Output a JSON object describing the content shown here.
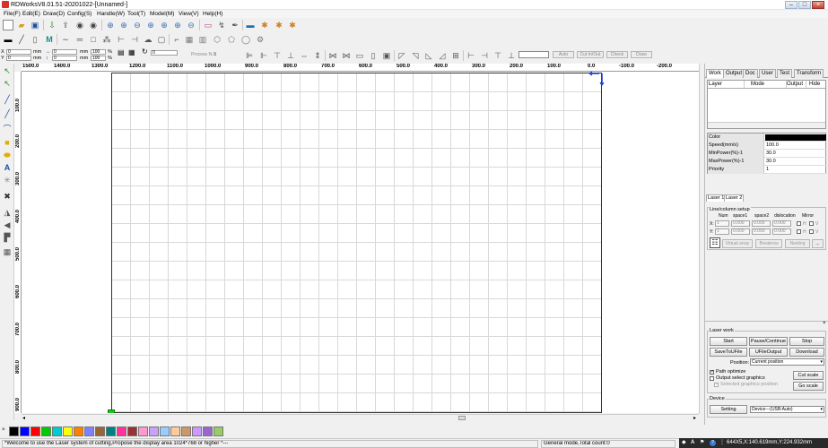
{
  "window": {
    "title": "RDWorksV8.01.51-20201022-[Unnamed-]"
  },
  "menu": [
    "File(F)",
    "Edit(E)",
    "Draw(D)",
    "Config(S)",
    "Handle(W)",
    "Tool(T)",
    "Model(M)",
    "View(V)",
    "Help(H)"
  ],
  "toolbar3": {
    "auto": "Auto",
    "cut_in_out": "Cut In/Out",
    "check": "Check",
    "draw": "Draw",
    "process_label": "Process N.0",
    "rotate_value": "0"
  },
  "coords": {
    "x_label": "X",
    "y_label": "Y",
    "x_value": "0",
    "y_value": "0",
    "unit": "mm",
    "w_value": "0",
    "h_value": "0",
    "pct_x": "100",
    "pct_y": "100",
    "pct": "%"
  },
  "ruler_top": [
    "1500.0",
    "1400.0",
    "1300.0",
    "1200.0",
    "1100.0",
    "1000.0",
    "900.0",
    "800.0",
    "700.0",
    "600.0",
    "500.0",
    "400.0",
    "300.0",
    "200.0",
    "100.0",
    "0.0",
    "-100.0",
    "-200.0"
  ],
  "ruler_left": [
    "100.0",
    "200.0",
    "300.0",
    "400.0",
    "500.0",
    "600.0",
    "700.0",
    "800.0",
    "900.0"
  ],
  "right_panel": {
    "tabs": [
      "Work",
      "Output",
      "Doc",
      "User",
      "Test",
      "Transform"
    ],
    "layer_headers": [
      "Layer",
      "Mode",
      "Output",
      "Hide"
    ],
    "props": [
      {
        "label": "Color",
        "value": ""
      },
      {
        "label": "Speed(mm/s)",
        "value": "100.0"
      },
      {
        "label": "MinPower(%)-1",
        "value": "30.0"
      },
      {
        "label": "MaxPower(%)-1",
        "value": "30.0"
      },
      {
        "label": "Priority",
        "value": "1"
      }
    ],
    "color_value": "#000000",
    "subtabs": [
      "Laser 1",
      "Laser 2"
    ],
    "line_column": {
      "title": "Line/column setup",
      "headers": [
        "Num",
        "space1",
        "space2",
        "dislocation",
        "Mirror"
      ],
      "x_label": "X:",
      "y_label": "Y:",
      "num": "1",
      "zero": "0.000",
      "mirror_h": "H",
      "mirror_v": "V",
      "virtual_array": "Virtual array",
      "breakrow": "Breakrow",
      "nesting": "Nesting",
      "more": "..."
    }
  },
  "laser_work": {
    "title": "Laser work",
    "start": "Start",
    "pause": "Pause/Continue",
    "stop": "Stop",
    "save_to_ufile": "SaveToUFile",
    "ufile_output": "UFileOutput",
    "download": "Download",
    "position_label": "Position:",
    "position_value": "Current position",
    "path_optimize": "Path optimize",
    "output_select": "Output select graphics",
    "selected_position": "Selected graphics position",
    "cut_scale": "Cut scale",
    "go_scale": "Go scale",
    "device_title": "Device",
    "setting": "Setting",
    "device_value": "Device---(USB:Auto)"
  },
  "palette": [
    "#000000",
    "#0000ff",
    "#ff0000",
    "#00cc00",
    "#00cccc",
    "#ffff00",
    "#ff8000",
    "#8080ff",
    "#996633",
    "#008080",
    "#ff3399",
    "#993333",
    "#ff99cc",
    "#c8a0ff",
    "#99ccff",
    "#ffcc99",
    "#cc9966",
    "#cc99ff",
    "#9966cc",
    "#99cc66"
  ],
  "status": {
    "message": "*Welcome to use the Laser system of cutting,Propose the display area 1024*768 or higher *---",
    "mode": "General mode,Total count:0",
    "coords": "644X5,X:140.619mm,Y:224.932mm"
  }
}
